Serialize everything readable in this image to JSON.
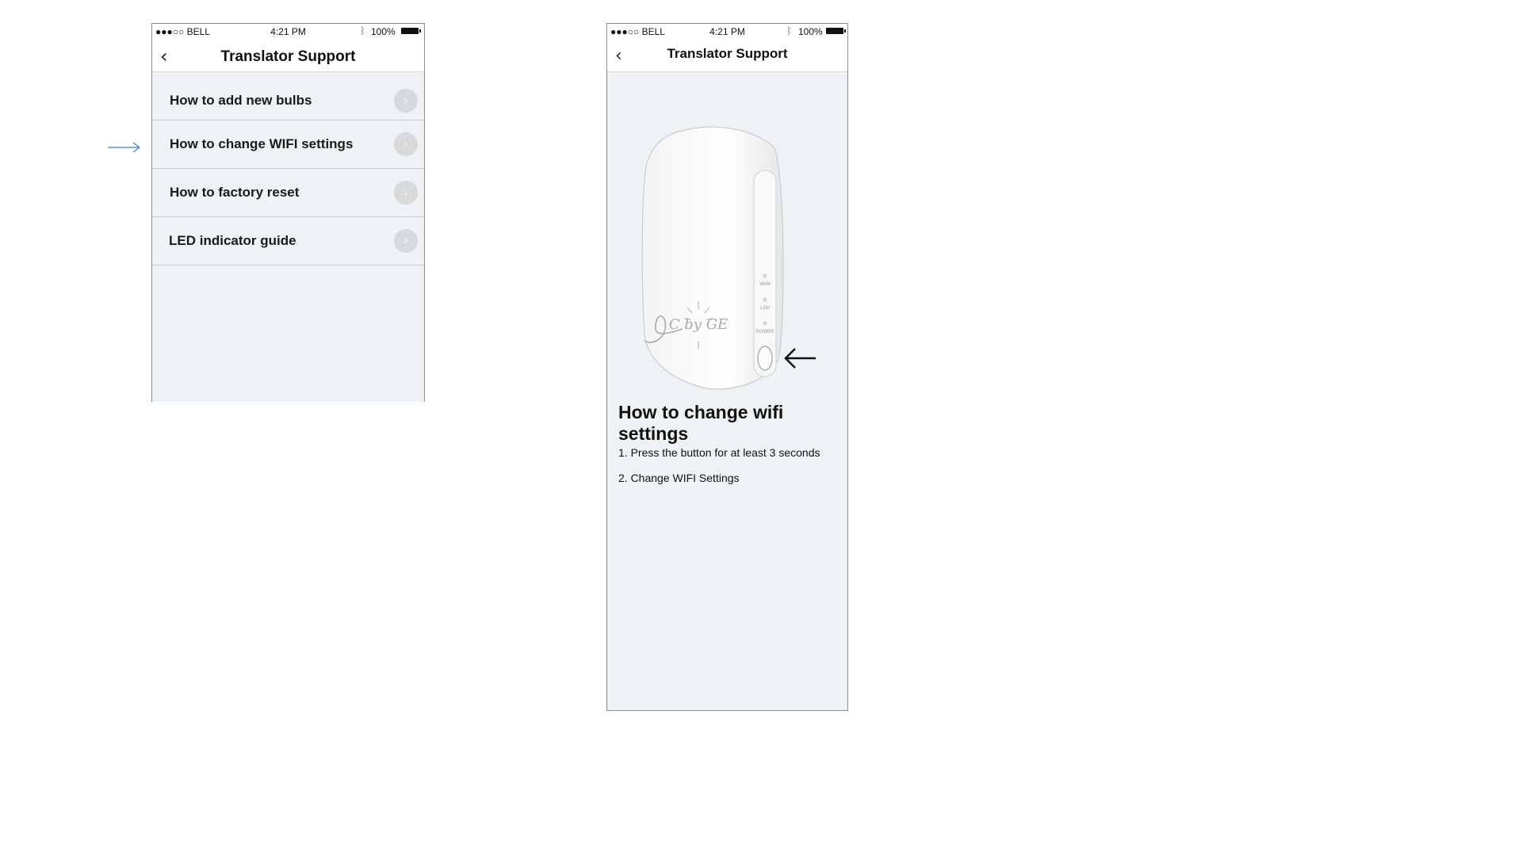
{
  "status_bar": {
    "carrier": "●●●○○ BELL ",
    "wifi": "wifi-icon",
    "time": "4:21 PM",
    "bluetooth": "ᛒ",
    "battery": "100%"
  },
  "screen1": {
    "title": "Translator Support",
    "back": "‹",
    "items": [
      {
        "label": "How to add new bulbs"
      },
      {
        "label": "How to change WIFI settings"
      },
      {
        "label": "How to factory reset"
      },
      {
        "label": "LED indicator guide"
      }
    ],
    "chevron": "›"
  },
  "screen2": {
    "title": "Translator Support",
    "back": "‹",
    "heading": "How to change wifi settings",
    "steps": [
      "1. Press the button for at least 3 seconds",
      "2. Change WIFI Settings"
    ],
    "device": {
      "logo": "C by GE",
      "leds": [
        "WAN",
        "LAN",
        "POWER"
      ]
    }
  },
  "colors": {
    "screen_bg": "#eff2f4",
    "pointer_blue": "#3b7fd1",
    "chevron_bg": "#d7d9db"
  }
}
